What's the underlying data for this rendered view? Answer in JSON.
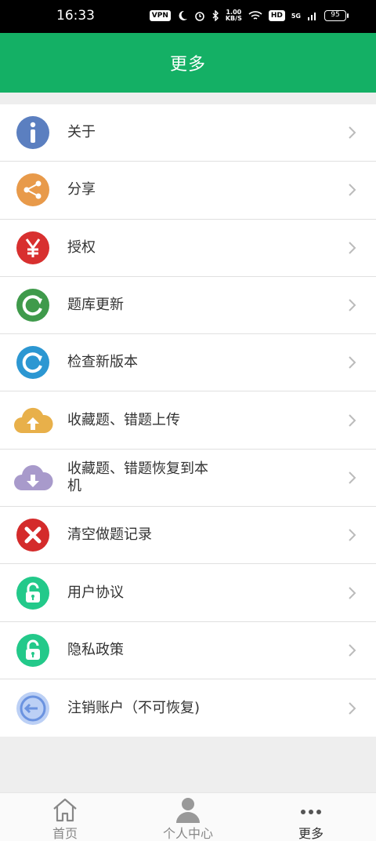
{
  "status": {
    "time": "16:33",
    "vpn": "VPN",
    "speed_value": "1.00",
    "speed_unit": "KB/S",
    "hd": "HD",
    "net": "5G",
    "battery": "95"
  },
  "header": {
    "title": "更多"
  },
  "menu": [
    {
      "label": "关于",
      "icon": "info-icon",
      "color": "#5b7fc0"
    },
    {
      "label": "分享",
      "icon": "share-icon",
      "color": "#e89a4a"
    },
    {
      "label": "授权",
      "icon": "yen-icon",
      "color": "#d8302f"
    },
    {
      "label": "题库更新",
      "icon": "refresh-icon",
      "color": "#3f9a4b"
    },
    {
      "label": "检查新版本",
      "icon": "refresh-icon",
      "color": "#2c97d2"
    },
    {
      "label": "收藏题、错题上传",
      "icon": "cloud-upload-icon",
      "color": "#e8b04a"
    },
    {
      "label": "收藏题、错题恢复到本机",
      "icon": "cloud-download-icon",
      "color": "#a89acb"
    },
    {
      "label": "清空做题记录",
      "icon": "close-icon",
      "color": "#d42b2b"
    },
    {
      "label": "用户协议",
      "icon": "lock-icon",
      "color": "#23c98a"
    },
    {
      "label": "隐私政策",
      "icon": "lock-icon",
      "color": "#23c98a"
    },
    {
      "label": "注销账户（不可恢复)",
      "icon": "logout-icon",
      "color": "#6b93e0"
    }
  ],
  "tabs": [
    {
      "label": "首页",
      "icon": "home-icon"
    },
    {
      "label": "个人中心",
      "icon": "user-icon"
    },
    {
      "label": "更多",
      "icon": "more-icon"
    }
  ]
}
